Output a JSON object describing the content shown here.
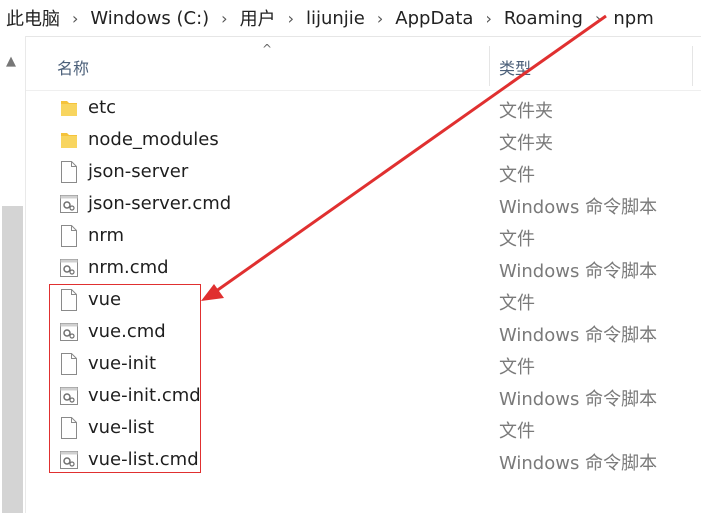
{
  "breadcrumb": [
    "此电脑",
    "Windows (C:)",
    "用户",
    "lijunjie",
    "AppData",
    "Roaming",
    "npm"
  ],
  "columns": {
    "name": "名称",
    "type": "类型"
  },
  "files": [
    {
      "name": "etc",
      "type": "文件夹",
      "icon": "folder-icon"
    },
    {
      "name": "node_modules",
      "type": "文件夹",
      "icon": "folder-icon"
    },
    {
      "name": "json-server",
      "type": "文件",
      "icon": "file-icon"
    },
    {
      "name": "json-server.cmd",
      "type": "Windows 命令脚本",
      "icon": "cmd-script-icon"
    },
    {
      "name": "nrm",
      "type": "文件",
      "icon": "file-icon"
    },
    {
      "name": "nrm.cmd",
      "type": "Windows 命令脚本",
      "icon": "cmd-script-icon"
    },
    {
      "name": "vue",
      "type": "文件",
      "icon": "file-icon"
    },
    {
      "name": "vue.cmd",
      "type": "Windows 命令脚本",
      "icon": "cmd-script-icon"
    },
    {
      "name": "vue-init",
      "type": "文件",
      "icon": "file-icon"
    },
    {
      "name": "vue-init.cmd",
      "type": "Windows 命令脚本",
      "icon": "cmd-script-icon"
    },
    {
      "name": "vue-list",
      "type": "文件",
      "icon": "file-icon"
    },
    {
      "name": "vue-list.cmd",
      "type": "Windows 命令脚本",
      "icon": "cmd-script-icon"
    }
  ],
  "annotation": {
    "color": "#e03030"
  },
  "colors": {
    "folder": "#f5c33b",
    "header_text": "#4c607a",
    "type_text": "#7a7a7a"
  }
}
